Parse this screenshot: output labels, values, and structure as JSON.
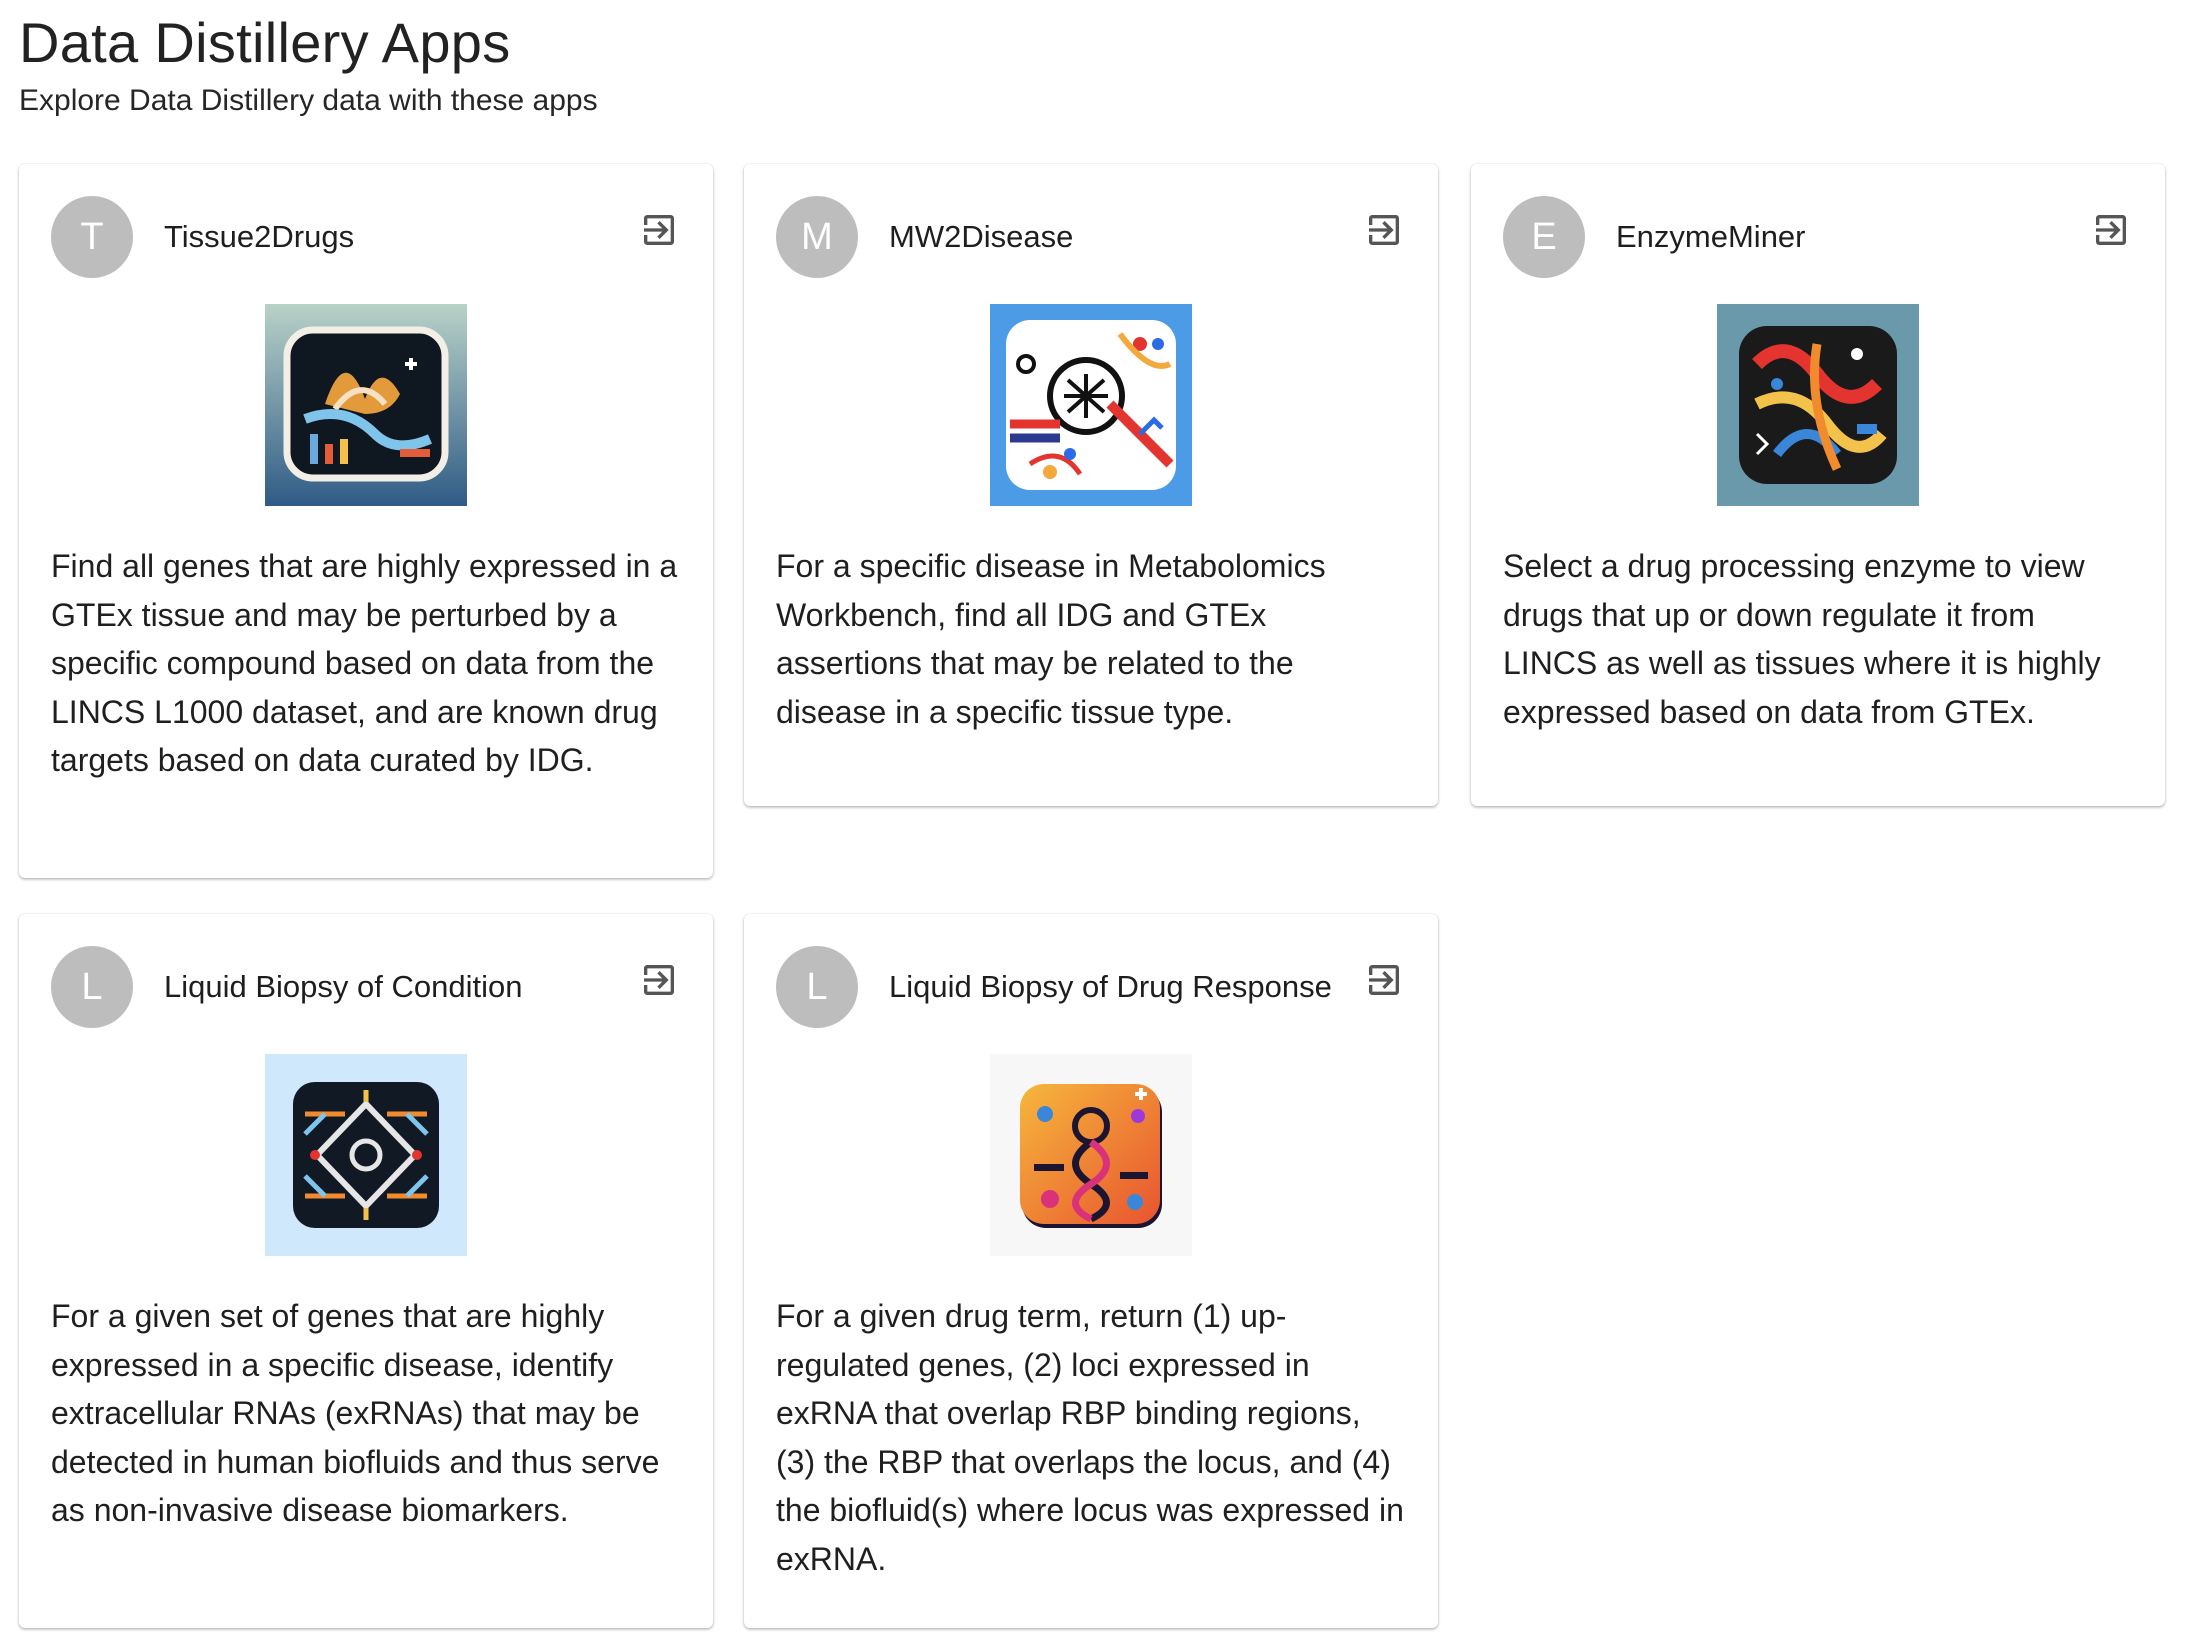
{
  "page": {
    "title": "Data Distillery Apps",
    "subtitle": "Explore Data Distillery data with these apps"
  },
  "icons": {
    "open": "open-in-app-icon"
  },
  "apps": [
    {
      "avatar": "T",
      "title": "Tissue2Drugs",
      "description": "Find all genes that are highly expressed in a GTEx tissue and may be perturbed by a specific compound based on data from the LINCS L1000 dataset, and are known drug targets based on data curated by IDG."
    },
    {
      "avatar": "M",
      "title": "MW2Disease",
      "description": "For a specific disease in Metabolomics Workbench, find all IDG and GTEx assertions that may be related to the disease in a specific tissue type."
    },
    {
      "avatar": "E",
      "title": "EnzymeMiner",
      "description": "Select a drug processing enzyme to view drugs that up or down regulate it from LINCS as well as tissues where it is highly expressed based on data from GTEx."
    },
    {
      "avatar": "L",
      "title": "Liquid Biopsy of Condition",
      "description": "For a given set of genes that are highly expressed in a specific disease, identify extracellular RNAs (exRNAs) that may be detected in human biofluids and thus serve as non-invasive disease biomarkers."
    },
    {
      "avatar": "L",
      "title": "Liquid Biopsy of Drug Response",
      "description": "For a given drug term, return (1) up-regulated genes, (2) loci expressed in exRNA that overlap RBP binding regions, (3) the RBP that overlaps the locus, and (4) the biofluid(s) where locus was expressed in exRNA."
    }
  ]
}
